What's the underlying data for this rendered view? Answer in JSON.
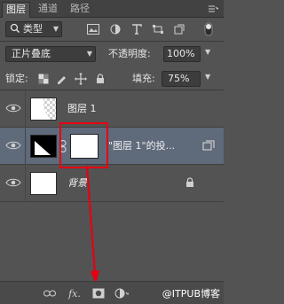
{
  "tabs": [
    {
      "label": "图层"
    },
    {
      "label": "通道"
    },
    {
      "label": "路径"
    }
  ],
  "filter": {
    "kind_label": "类型"
  },
  "blend": {
    "mode": "正片叠底",
    "opacity_label": "不透明度:",
    "opacity_value": "100%"
  },
  "lock": {
    "label": "锁定:",
    "fill_label": "填充:",
    "fill_value": "75%"
  },
  "layers": [
    {
      "name": "图层 1"
    },
    {
      "name": "\"图层 1\"的投..."
    },
    {
      "name": "背景"
    }
  ],
  "bottom": {
    "fx_label": "fx.",
    "watermark": "@ITPUB博客"
  },
  "colors": {
    "highlight": "#e60012",
    "selection": "#5f6a7b"
  }
}
